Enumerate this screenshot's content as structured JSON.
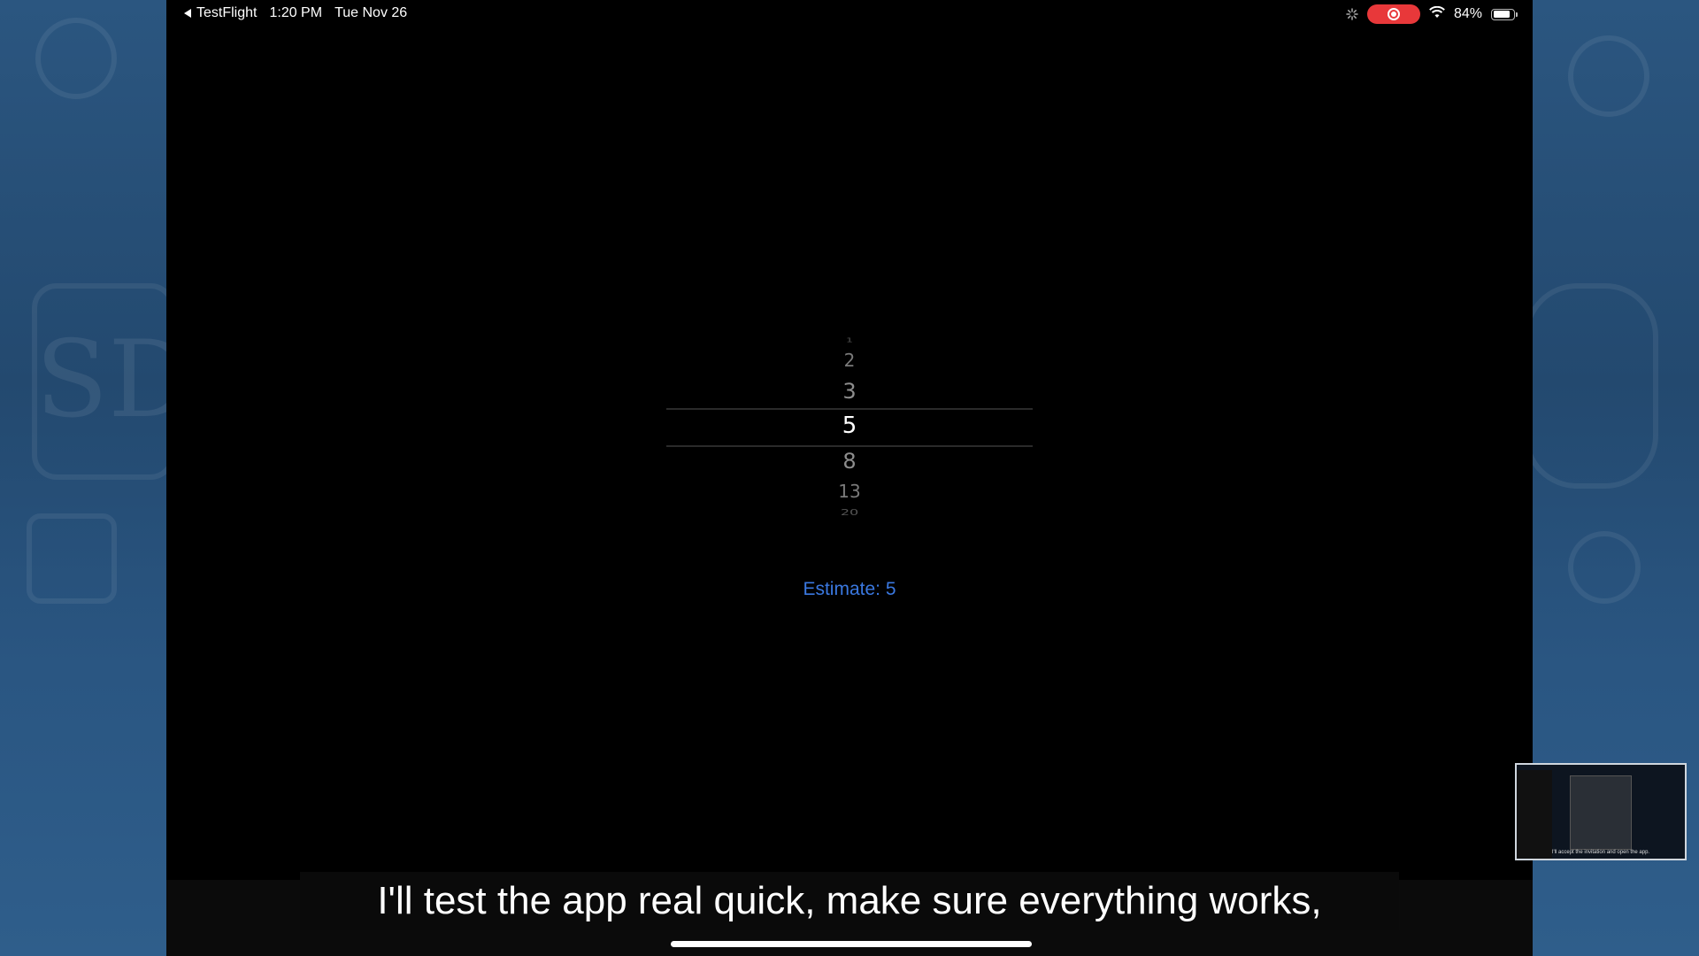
{
  "status_bar": {
    "back_app": "TestFlight",
    "time": "1:20 PM",
    "date": "Tue Nov 26",
    "battery": "84%",
    "battery_level": 0.84,
    "recording_color": "#e8383a"
  },
  "picker": {
    "items": [
      "1",
      "2",
      "3",
      "5",
      "8",
      "13",
      "20"
    ],
    "selected": "5"
  },
  "estimate_label": "Estimate: 5",
  "caption": "I'll test the app real quick, make sure everything works,",
  "thumbnail": {
    "caption": "I'll accept the invitation and open the app."
  },
  "colors": {
    "accent": "#3a78e0",
    "background": "#000000"
  }
}
